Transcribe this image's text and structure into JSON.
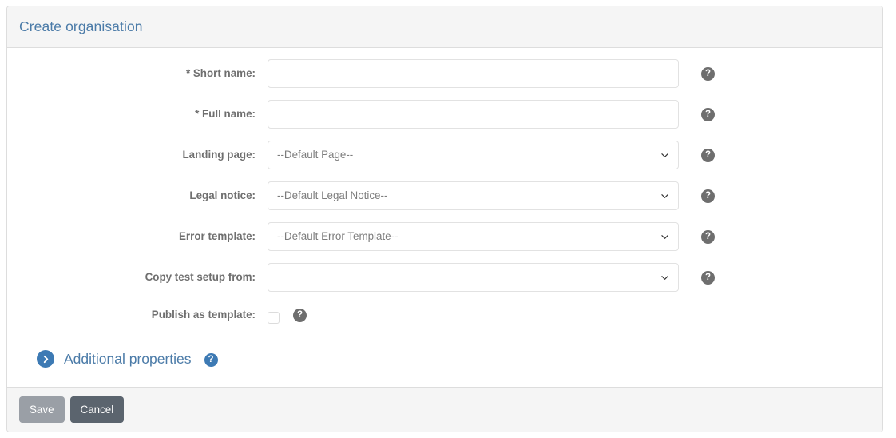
{
  "panel": {
    "title": "Create organisation"
  },
  "form": {
    "rows": [
      {
        "label": "* Short name:",
        "type": "text",
        "value": "",
        "placeholder": "",
        "name": "short-name",
        "help_icon": "question-mark-icon",
        "help_label": "?"
      },
      {
        "label": "* Full name:",
        "type": "text",
        "value": "",
        "placeholder": "",
        "name": "full-name",
        "help_icon": "question-mark-icon",
        "help_label": "?"
      },
      {
        "label": "Landing page:",
        "type": "select",
        "value": "--Default Page--",
        "name": "landing-page",
        "help_icon": "question-mark-icon",
        "help_label": "?"
      },
      {
        "label": "Legal notice:",
        "type": "select",
        "value": "--Default Legal Notice--",
        "name": "legal-notice",
        "help_icon": "question-mark-icon",
        "help_label": "?"
      },
      {
        "label": "Error template:",
        "type": "select",
        "value": "--Default Error Template--",
        "name": "error-template",
        "help_icon": "question-mark-icon",
        "help_label": "?"
      },
      {
        "label": "Copy test setup from:",
        "type": "select",
        "value": "",
        "name": "copy-test-setup-from",
        "help_icon": "question-mark-icon",
        "help_label": "?"
      }
    ],
    "checkbox_row": {
      "label": "Publish as template:",
      "checked": false,
      "name": "publish-as-template",
      "help_label": "?"
    }
  },
  "additional_properties": {
    "label": "Additional properties",
    "expand_icon": "chevron-right-icon",
    "help_label": "?",
    "expanded": false
  },
  "footer": {
    "save_label": "Save",
    "cancel_label": "Cancel"
  },
  "colors": {
    "link_blue": "#4b7ba8",
    "icon_blue": "#3d7ab4",
    "help_gray": "#6e6e6e",
    "label_gray": "#6f6f6f",
    "panel_header_bg": "#f5f5f5",
    "border": "#dddddd",
    "save_btn": "#9a9fa6",
    "cancel_btn": "#5b646e"
  }
}
